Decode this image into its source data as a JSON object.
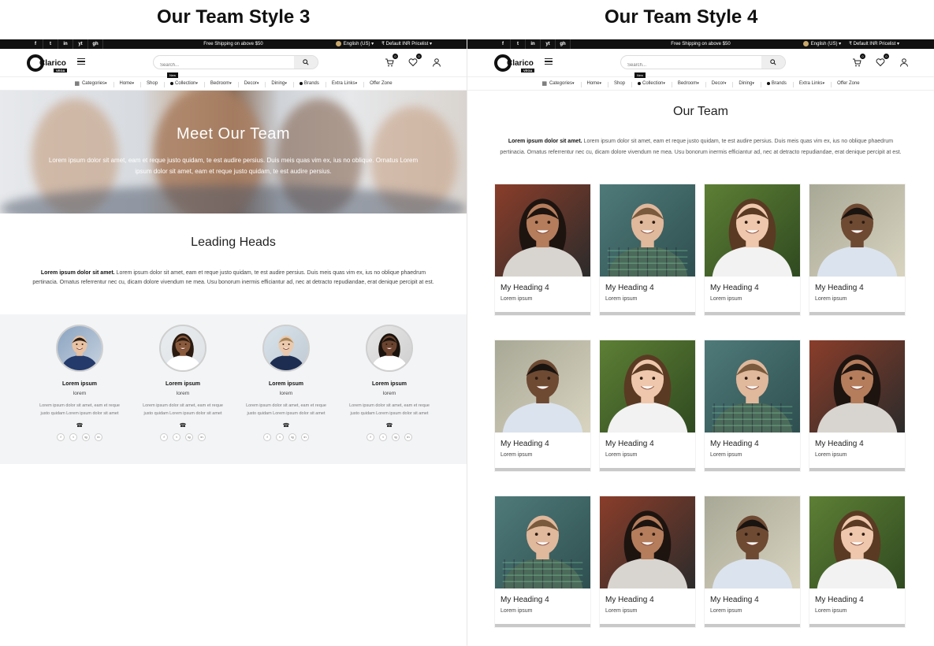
{
  "titles": {
    "left": "Our Team Style 3",
    "right": "Our Team Style 4"
  },
  "topbar": {
    "socials": [
      "f",
      "t",
      "in",
      "yt",
      "gh"
    ],
    "shipping": "Free Shipping on above $50",
    "language": "English (US)",
    "pricelist": "₹ Default INR Pricelist"
  },
  "header": {
    "logo": "Clarico",
    "logo_sub": "VEGA",
    "search_placeholder": "Search...",
    "cart_count": "0",
    "wishlist_count": "0"
  },
  "nav": {
    "items": [
      "Categories",
      "Home",
      "Shop",
      "Collection",
      "Bedroom",
      "Decor",
      "Dining",
      "Brands",
      "Extra Links",
      "Offer Zone"
    ],
    "new_tag": "New"
  },
  "left": {
    "hero_title": "Meet Our Team",
    "hero_desc": "Lorem ipsum dolor sit amet, eam et reque justo quidam, te est audire persius. Duis meis quas vim ex, ius no oblique. Ornatus Lorem ipsum dolor sit amet, eam et reque justo quidam, te est audire persius.",
    "lead_title": "Leading Heads",
    "lead_bold": "Lorem ipsum dolor sit amet.",
    "lead_text": " Lorem ipsum dolor sit amet, eam et reque justo quidam, te est audire persius. Duis meis quas vim ex, ius no oblique phaedrum pertinacia. Ornatus referrentur nec cu, dicam dolore vivendum ne mea. Usu bonorum inermis efficiantur ad, nec at detracto repudiandae, erat denique percipit at est.",
    "members": [
      {
        "name": "Lorem ipsum",
        "role": "lorem",
        "bio": "Lorem ipsum dolor sit amet, eam et reque justo quidam Lorem ipsum dolor sit amet",
        "phone": "☎"
      },
      {
        "name": "Lorem ipsum",
        "role": "lorem",
        "bio": "Lorem ipsum dolor sit amet, eam et reque justo quidam Lorem ipsum dolor sit amet",
        "phone": "☎"
      },
      {
        "name": "Lorem ipsum",
        "role": "lorem",
        "bio": "Lorem ipsum dolor sit amet, eam et reque justo quidam Lorem ipsum dolor sit amet",
        "phone": "☎"
      },
      {
        "name": "Lorem ipsum",
        "role": "lorem",
        "bio": "Lorem ipsum dolor sit amet, eam et reque justo quidam Lorem ipsum dolor sit amet",
        "phone": "☎"
      }
    ],
    "member_socials": [
      "f",
      "t",
      "ig",
      "in"
    ]
  },
  "right": {
    "team_title": "Our Team",
    "desc_bold": "Lorem ipsum dolor sit amet.",
    "desc_text": " Lorem ipsum dolor sit amet, eam et reque justo quidam, te est audire persius. Duis meis quas vim ex, ius no oblique phaedrum pertinacia. Ornatus referrentur nec cu, dicam dolore vivendum ne mea. Usu bonorum inermis efficiantur ad, nec at detracto repudiandae, erat denique percipit at est.",
    "cards": [
      {
        "heading": "My Heading 4",
        "sub": "Lorem ipsum",
        "person": "woman-curly"
      },
      {
        "heading": "My Heading 4",
        "sub": "Lorem ipsum",
        "person": "man-plaid"
      },
      {
        "heading": "My Heading 4",
        "sub": "Lorem ipsum",
        "person": "woman-brunette"
      },
      {
        "heading": "My Heading 4",
        "sub": "Lorem ipsum",
        "person": "man-smiling"
      },
      {
        "heading": "My Heading 4",
        "sub": "Lorem ipsum",
        "person": "man-smiling"
      },
      {
        "heading": "My Heading 4",
        "sub": "Lorem ipsum",
        "person": "woman-brunette"
      },
      {
        "heading": "My Heading 4",
        "sub": "Lorem ipsum",
        "person": "man-plaid"
      },
      {
        "heading": "My Heading 4",
        "sub": "Lorem ipsum",
        "person": "woman-curly"
      },
      {
        "heading": "My Heading 4",
        "sub": "Lorem ipsum",
        "person": "man-plaid"
      },
      {
        "heading": "My Heading 4",
        "sub": "Lorem ipsum",
        "person": "woman-curly"
      },
      {
        "heading": "My Heading 4",
        "sub": "Lorem ipsum",
        "person": "man-smiling"
      },
      {
        "heading": "My Heading 4",
        "sub": "Lorem ipsum",
        "person": "woman-brunette"
      }
    ]
  }
}
